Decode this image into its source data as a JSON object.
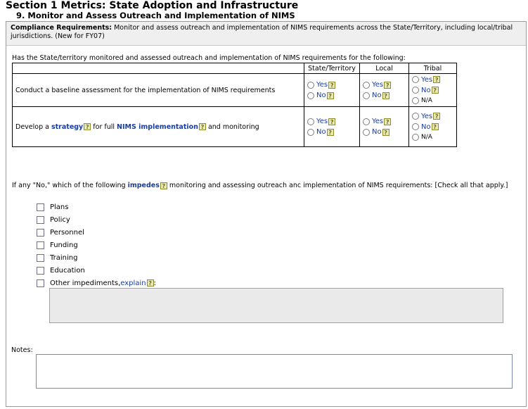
{
  "header": {
    "section_title": "Section 1 Metrics:  State Adoption and Infrastructure",
    "subsection_title": "9. Monitor and Assess Outreach and Implementation of NIMS"
  },
  "compliance": {
    "label": "Compliance Requirements:",
    "text": " Monitor and assess outreach and implementation of NIMS requirements across the State/Territory, including local/tribal jurisdictions. (New for FY07)"
  },
  "question": "Has the State/territory monitored and assessed outreach and implementation of NIMS requirements for the following:",
  "table": {
    "columns": [
      "State/Territory",
      "Local",
      "Tribal"
    ],
    "rows": [
      {
        "task": "Conduct a baseline assessment for the implementation of NIMS requirements"
      },
      {
        "task_pre": "Develop a ",
        "task_link1": "strategy",
        "task_mid": " for full ",
        "task_link2": "NIMS implementation",
        "task_post": " and monitoring"
      }
    ],
    "options": {
      "yes": "Yes",
      "no": "No",
      "na": "N/A"
    },
    "help_glyph": "?"
  },
  "impede": {
    "pre": "If any \"No,\" which of the following ",
    "link": "impedes",
    "post": " monitoring and assessing outreach anc implementation of NIMS requirements: [Check all that apply.]"
  },
  "checkboxes": [
    "Plans",
    "Policy",
    "Personnel",
    "Funding",
    "Training",
    "Education"
  ],
  "other": {
    "pre": "Other impediments, ",
    "link": "explain",
    "post": ":"
  },
  "notes_label": "Notes:"
}
